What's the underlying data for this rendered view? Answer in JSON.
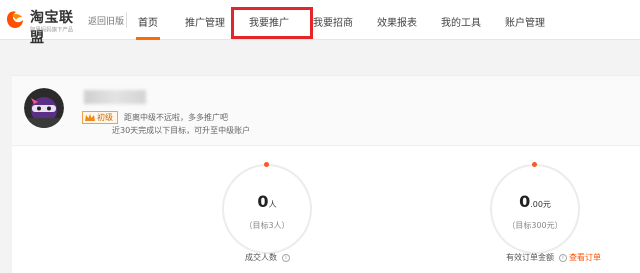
{
  "header": {
    "logo_text": "淘宝联盟",
    "logo_sub": "阿里妈妈旗下产品",
    "back_old": "返回旧版",
    "nav": [
      {
        "label": "首页",
        "active": true
      },
      {
        "label": "推广管理",
        "active": false
      },
      {
        "label": "我要推广",
        "active": false,
        "highlighted": true
      },
      {
        "label": "我要招商",
        "active": false
      },
      {
        "label": "效果报表",
        "active": false
      },
      {
        "label": "我的工具",
        "active": false
      },
      {
        "label": "账户管理",
        "active": false
      }
    ],
    "accent_color": "#ff6a00",
    "highlight_color": "#e3262a"
  },
  "profile": {
    "level": "初级",
    "tip_line1": "距离中级不远啦，多多推广吧",
    "tip_line2": "近30天完成以下目标，可升至中级账户"
  },
  "stats": [
    {
      "value": "0",
      "unit": "人",
      "target": "（目标3人）",
      "label": "成交人数",
      "info": "i"
    },
    {
      "value": "0",
      "unit": ".00元",
      "target": "（目标300元）",
      "label": "有效订单金额",
      "info": "i",
      "link": "查看订单"
    }
  ],
  "icons": {
    "logo": "taobao-union-logo",
    "level": "crown-icon",
    "info": "info-icon"
  }
}
